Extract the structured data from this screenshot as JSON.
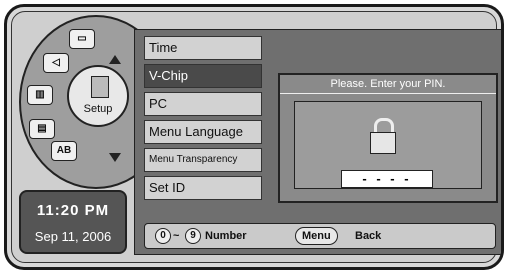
{
  "dial": {
    "center_label": "Setup",
    "segments": [
      "AB"
    ]
  },
  "clock": {
    "time": "11:20 PM",
    "date": "Sep 11, 2006"
  },
  "menu": {
    "items": [
      {
        "label": "Time"
      },
      {
        "label": "V-Chip"
      },
      {
        "label": "PC"
      },
      {
        "label": "Menu Language"
      },
      {
        "label": "Menu Transparency"
      },
      {
        "label": "Set ID"
      }
    ]
  },
  "pin_dialog": {
    "title": "Please. Enter your PIN.",
    "value": "- - - -"
  },
  "footer": {
    "key_start": "0",
    "key_sep": "~",
    "key_end": "9",
    "number_label": "Number",
    "menu_key": "Menu",
    "back_label": "Back"
  }
}
